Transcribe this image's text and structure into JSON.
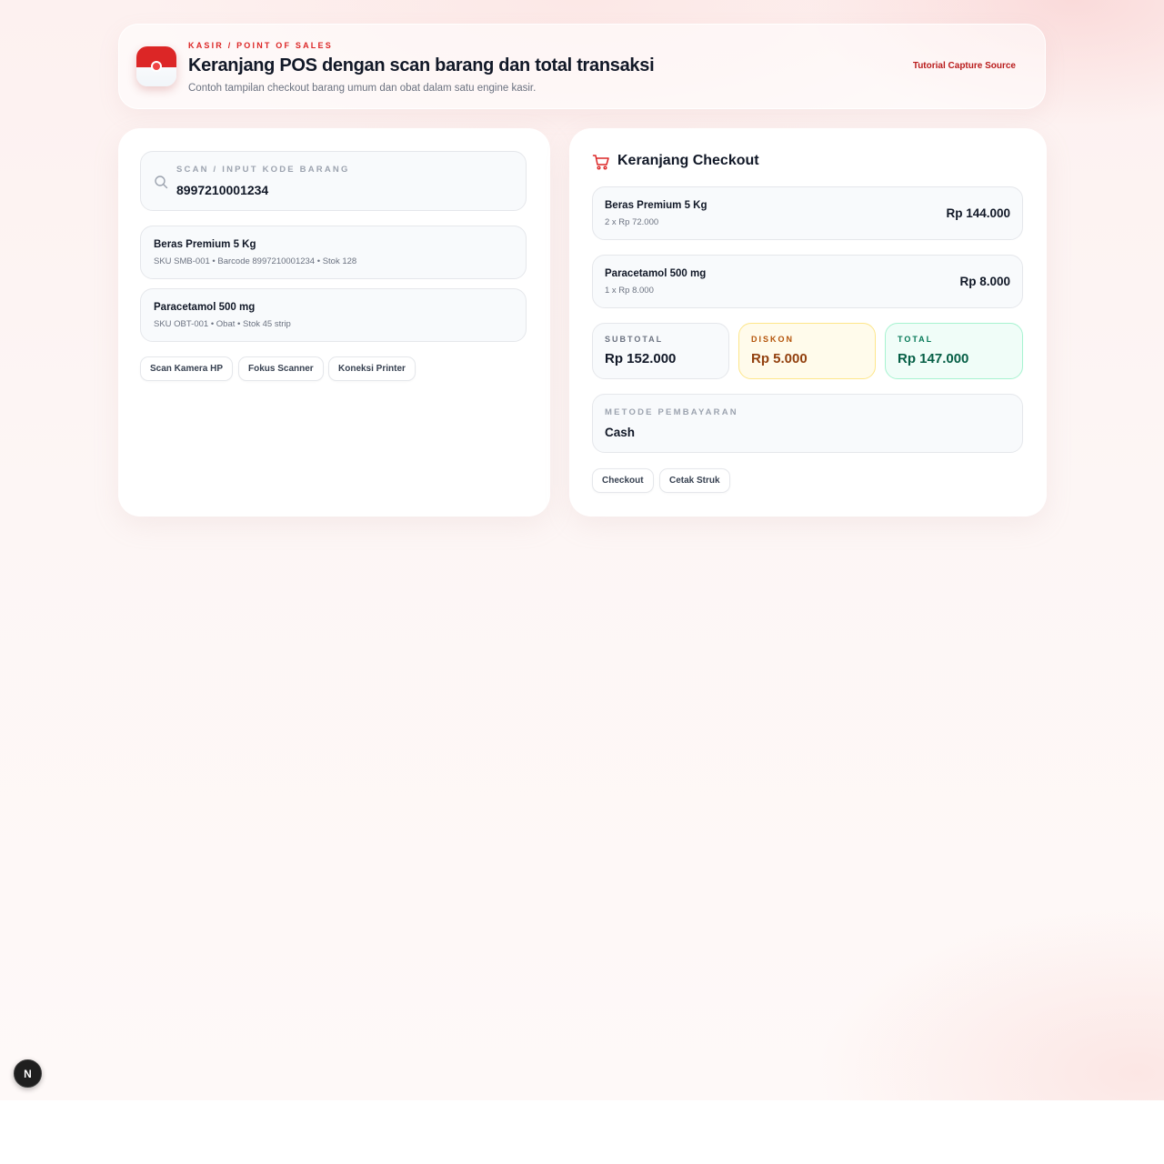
{
  "header": {
    "eyebrow": "KASIR / POINT OF SALES",
    "title": "Keranjang POS dengan scan barang dan total transaksi",
    "subtitle": "Contoh tampilan checkout barang umum dan obat dalam satu engine kasir.",
    "link": "Tutorial Capture Source",
    "logo_icon": "app-logo-icon"
  },
  "scan": {
    "label": "SCAN / INPUT KODE BARANG",
    "value": "8997210001234",
    "icon": "search-icon"
  },
  "products": [
    {
      "name": "Beras Premium 5 Kg",
      "meta": "SKU SMB-001 • Barcode 8997210001234 • Stok 128"
    },
    {
      "name": "Paracetamol 500 mg",
      "meta": "SKU OBT-001 • Obat • Stok 45 strip"
    }
  ],
  "left_actions": {
    "scan_camera": "Scan Kamera HP",
    "focus_scanner": "Fokus Scanner",
    "printer": "Koneksi Printer"
  },
  "cart": {
    "title": "Keranjang Checkout",
    "icon": "cart-icon",
    "items": [
      {
        "name": "Beras Premium 5 Kg",
        "meta": "2 x Rp 72.000",
        "price": "Rp 144.000"
      },
      {
        "name": "Paracetamol 500 mg",
        "meta": "1 x Rp 8.000",
        "price": "Rp 8.000"
      }
    ],
    "summary": {
      "subtotal_label": "SUBTOTAL",
      "subtotal_value": "Rp 152.000",
      "discount_label": "DISKON",
      "discount_value": "Rp 5.000",
      "total_label": "TOTAL",
      "total_value": "Rp 147.000"
    },
    "payment": {
      "label": "METODE PEMBAYARAN",
      "value": "Cash"
    },
    "actions": {
      "checkout": "Checkout",
      "print": "Cetak Struk"
    }
  },
  "badge": {
    "letter": "N"
  },
  "colors": {
    "accent": "#dc2626",
    "discount": "#92400e",
    "total": "#065f46"
  }
}
